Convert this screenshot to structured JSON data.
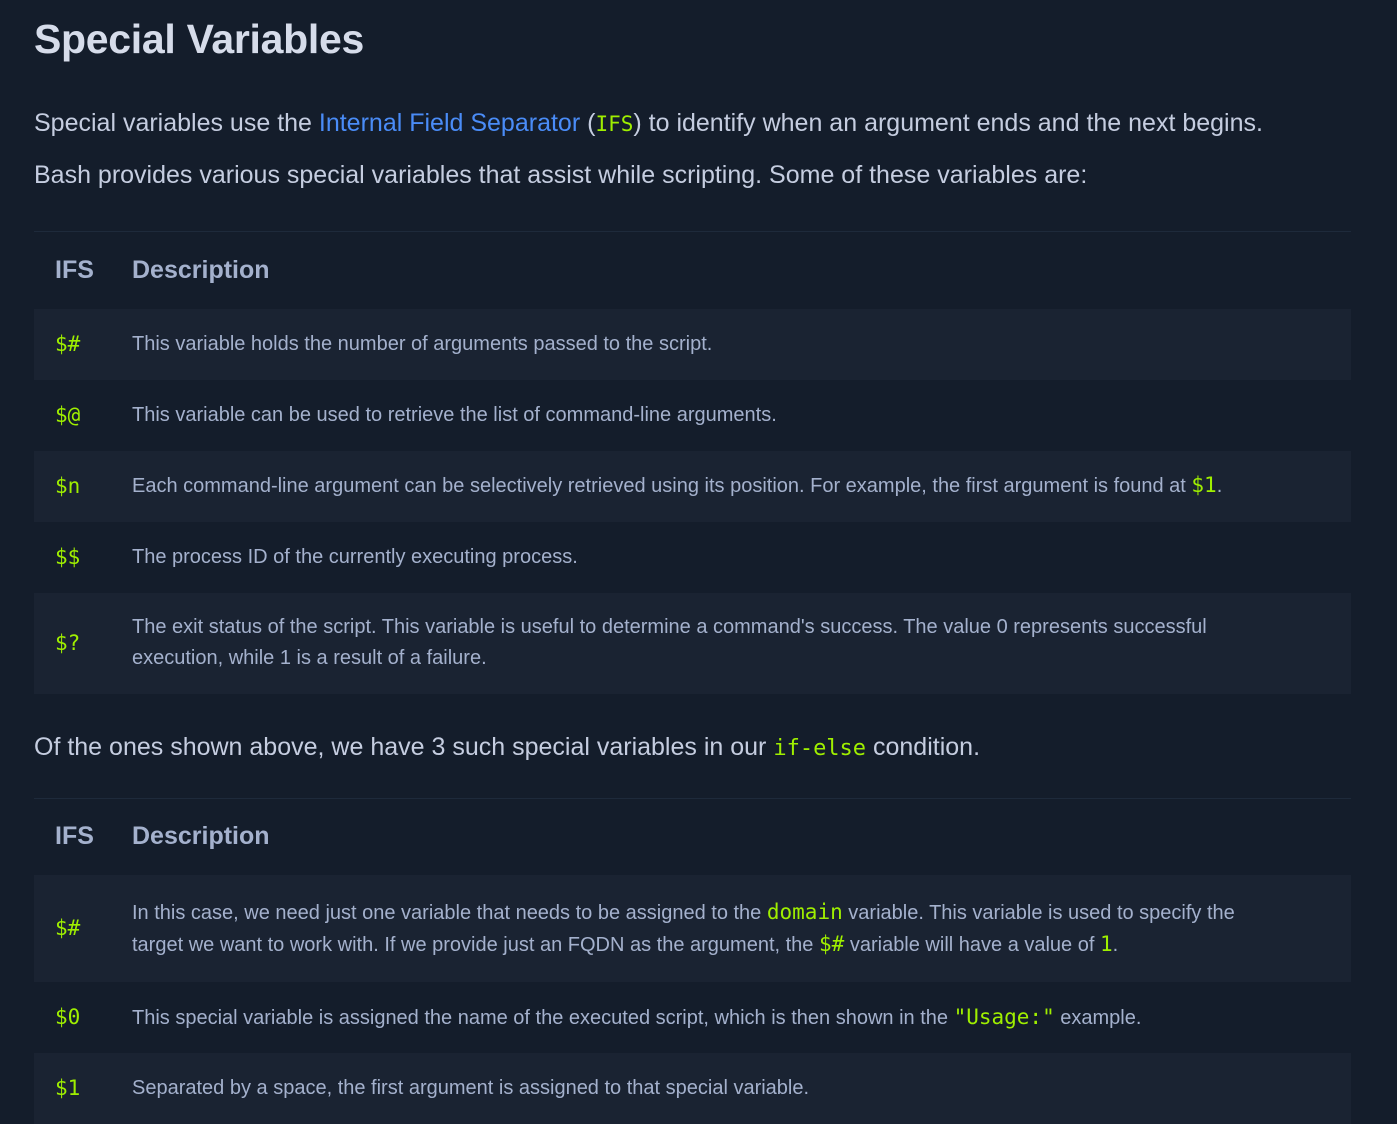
{
  "heading": "Special Variables",
  "intro": {
    "before_link": "Special variables use the ",
    "link_text": "Internal Field Separator",
    "open_paren": " (",
    "code": "IFS",
    "after_code": ") to identify when an argument ends and the next begins."
  },
  "second_para": "Bash provides various special variables that assist while scripting. Some of these variables are:",
  "table1": {
    "headers": [
      "IFS",
      "Description"
    ],
    "rows": [
      {
        "var": "$#",
        "desc": "This variable holds the number of arguments passed to the script."
      },
      {
        "var": "$@",
        "desc": "This variable can be used to retrieve the list of command-line arguments."
      },
      {
        "var": "$n",
        "desc_before": "Each command-line argument can be selectively retrieved using its position. For example, the first argument is found at ",
        "desc_code": "$1",
        "desc_after": "."
      },
      {
        "var": "$$",
        "desc": "The process ID of the currently executing process."
      },
      {
        "var": "$?",
        "desc": "The exit status of the script. This variable is useful to determine a command's success. The value 0 represents successful execution, while 1 is a result of a failure."
      }
    ]
  },
  "third_para": {
    "before": "Of the ones shown above, we have 3 such special variables in our ",
    "code": "if-else",
    "after": " condition."
  },
  "table2": {
    "headers": [
      "IFS",
      "Description"
    ],
    "rows": [
      {
        "var": "$#",
        "desc_a": "In this case, we need just one variable that needs to be assigned to the ",
        "code_a": "domain",
        "desc_b": " variable. This variable is used to specify the target we want to work with. If we provide just an FQDN as the argument, the ",
        "code_b": "$#",
        "desc_c": " variable will have a value of ",
        "code_c": "1",
        "desc_d": "."
      },
      {
        "var": "$0",
        "desc_a": "This special variable is assigned the name of the executed script, which is then shown in the ",
        "code_a": "\"Usage:\"",
        "desc_b": " example."
      },
      {
        "var": "$1",
        "desc": "Separated by a space, the first argument is assigned to that special variable."
      }
    ]
  },
  "colors": {
    "background": "#141d2b",
    "row_alt": "#1a2332",
    "code": "#9fef00",
    "link": "#4a8cf7",
    "text": "#a4b1cd",
    "heading": "#d6dcea"
  }
}
